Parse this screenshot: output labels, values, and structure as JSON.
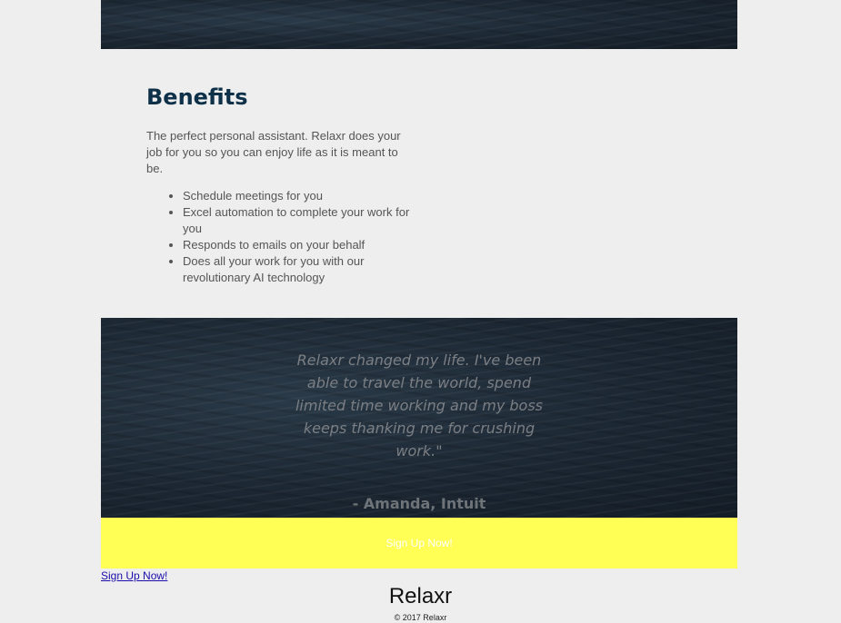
{
  "benefits": {
    "heading": "Benefits",
    "intro": "The perfect personal assistant. Relaxr does your job for you so you can enjoy life as it is meant to be.",
    "items": [
      "Schedule meetings for you",
      "Excel automation to complete your work for you",
      "Responds to emails on your behalf",
      "Does all your work for you with our revolutionary AI technology"
    ]
  },
  "testimonial": {
    "quote": "Relaxr changed my life. I've been able to travel the world, spend limited time working and my boss keeps thanking me for crushing work.\"",
    "author": "- Amanda, Intuit"
  },
  "signup": {
    "button_label": "Sign Up Now!",
    "link_text": "Sign Up Now!"
  },
  "footer": {
    "brand": "Relaxr",
    "copyright": "© 2017 Relaxr"
  },
  "colors": {
    "heading": "#0e3048",
    "body_text": "#555555",
    "signup_bar": "#ffff55",
    "link": "#1a0dab",
    "page_background": "#eeeeee"
  }
}
